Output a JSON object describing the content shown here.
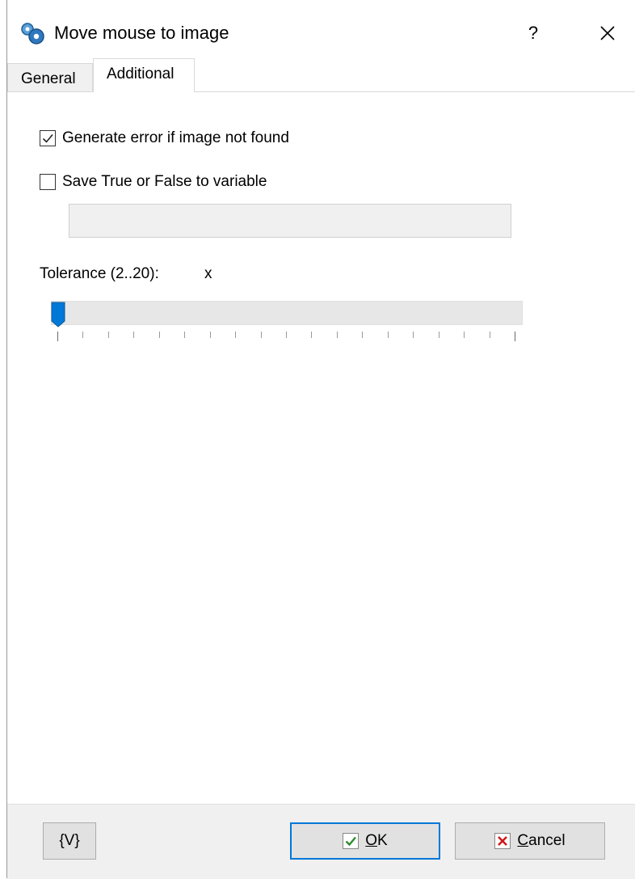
{
  "window": {
    "title": "Move mouse to image",
    "help_label": "?"
  },
  "tabs": [
    {
      "label": "General",
      "active": false
    },
    {
      "label": "Additional",
      "active": true
    }
  ],
  "options": {
    "generate_error": {
      "label": "Generate error if image not found",
      "checked": true
    },
    "save_to_variable": {
      "label": "Save True or False to variable",
      "checked": false
    },
    "variable_value": ""
  },
  "tolerance": {
    "label": "Tolerance (2..20):",
    "value_text": "x",
    "min": 2,
    "max": 20,
    "value": 2
  },
  "footer": {
    "variables_button": "{V}",
    "ok_first": "O",
    "ok_rest": "K",
    "cancel_first": "C",
    "cancel_rest": "ancel"
  },
  "colors": {
    "accent": "#0078d7",
    "ok_check": "#2e8b2e",
    "cancel_x": "#d11a1a"
  },
  "icons": [
    "app-gears-icon",
    "close-icon",
    "checkmark-icon",
    "slider-thumb-icon",
    "ok-check-icon",
    "cancel-x-icon"
  ]
}
